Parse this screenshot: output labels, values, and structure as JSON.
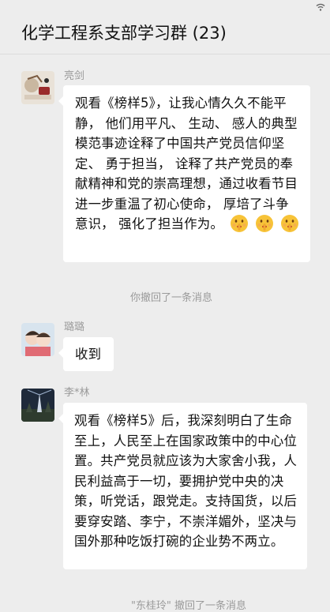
{
  "chat": {
    "title": "化学工程系支部学习群 (23)"
  },
  "messages": [
    {
      "sender": "亮剑",
      "text": "观看《榜样5》，让我心情久久不能平静， 他们用平凡、 生动、 感人的典型模范事迹诠释了中国共产党员信仰坚定、 勇于担当， 诠释了共产党员的奉献精神和党的崇高理想，通过收看节目进一步重温了初心使命， 厚培了斗争意识， 强化了担当作为。",
      "emojis": [
        "shushing-face-emoji",
        "shushing-face-emoji",
        "shushing-face-emoji"
      ]
    },
    {
      "system": "你撤回了一条消息"
    },
    {
      "sender": "璐璐",
      "text": "收到"
    },
    {
      "sender": "李*林",
      "text": "观看《榜样5》后，我深刻明白了生命至上，人民至上在国家政策中的中心位置。共产党员就应该为大家舍小我，人民利益高于一切，要拥护党中央的决策，听党话，跟党走。支持国货，以后要穿安踏、李宁，不崇洋媚外，坚决与国外那种吃饭打碗的企业势不两立。"
    },
    {
      "system": "\"东桂玲\" 撤回了一条消息"
    }
  ],
  "colors": {
    "background": "#ededed",
    "bubble": "#ffffff",
    "meta_text": "#9a9a9a"
  }
}
